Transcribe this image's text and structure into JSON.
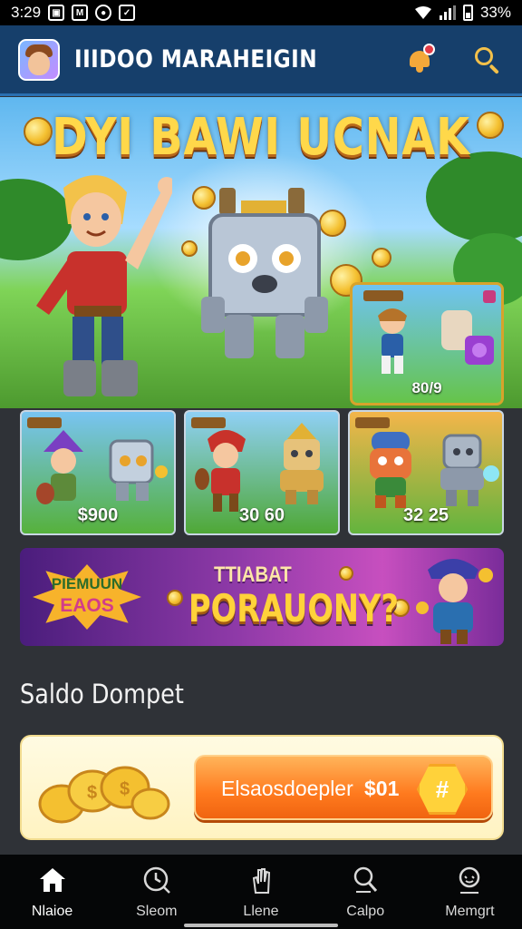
{
  "status_bar": {
    "time": "3:29",
    "battery": "33%"
  },
  "app_bar": {
    "title": "IIIDOO MARAHEIGIN"
  },
  "hero": {
    "title": "DYI BAWI UCNAK",
    "featured_price": "80/9"
  },
  "games": [
    {
      "price": "$900"
    },
    {
      "price": "30 60"
    },
    {
      "price": "32 25"
    }
  ],
  "promo": {
    "badge_line1": "PIEMUUN",
    "badge_line2": "EAOS",
    "subtitle": "TTIABAT",
    "title": "PORAUONY?"
  },
  "wallet": {
    "section_title": "Saldo Dompet",
    "button_label": "Elsaosdoepler",
    "amount": "$01",
    "button_icon": "#"
  },
  "nav": [
    {
      "label": "Nlaioe",
      "icon": "home-icon",
      "active": true
    },
    {
      "label": "Sleom",
      "icon": "clock-icon",
      "active": false
    },
    {
      "label": "Llene",
      "icon": "hand-icon",
      "active": false
    },
    {
      "label": "Calpo",
      "icon": "search-icon",
      "active": false
    },
    {
      "label": "Memgrt",
      "icon": "profile-icon",
      "active": false
    }
  ],
  "colors": {
    "app_bar": "#163f6b",
    "background": "#2f3237",
    "accent_gold": "#ffd84a",
    "button_orange": "#ff7a1e",
    "nav_bg": "#050607"
  }
}
